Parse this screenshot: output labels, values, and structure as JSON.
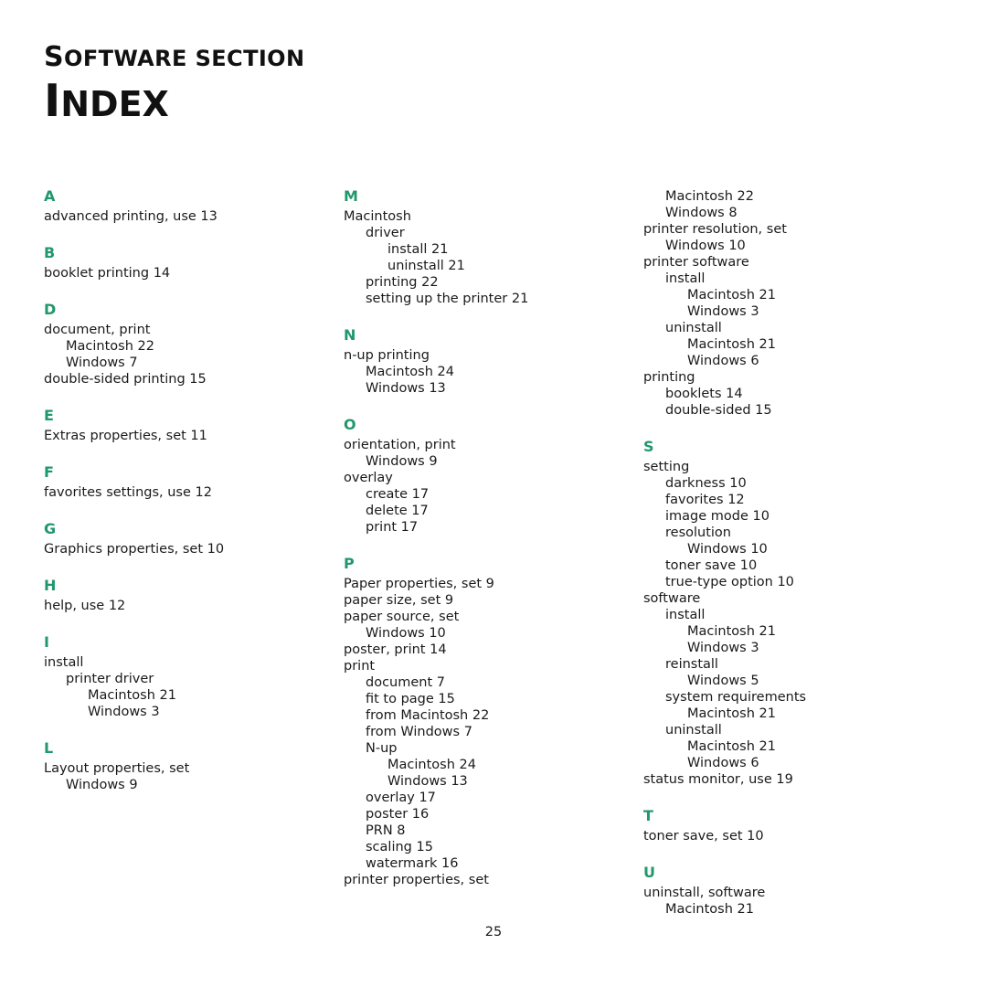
{
  "header": {
    "kicker": "Software section",
    "kicker_first": "S",
    "kicker_rest": "OFTWARE SECTION",
    "title": "Index",
    "title_first": "I",
    "title_rest": "NDEX"
  },
  "colors": {
    "letter_heading": "#21986c",
    "body_text": "#1a1a1a",
    "background": "#ffffff"
  },
  "footer": {
    "page_number": "25"
  },
  "columns": [
    {
      "id": "column-1",
      "continuation": [],
      "sections": [
        {
          "letter": "A",
          "entries": [
            {
              "text": "advanced printing, use 13",
              "level": 0
            }
          ]
        },
        {
          "letter": "B",
          "entries": [
            {
              "text": "booklet printing 14",
              "level": 0
            }
          ]
        },
        {
          "letter": "D",
          "entries": [
            {
              "text": "document, print",
              "level": 0
            },
            {
              "text": "Macintosh 22",
              "level": 1
            },
            {
              "text": "Windows 7",
              "level": 1
            },
            {
              "text": "double-sided printing 15",
              "level": 0
            }
          ]
        },
        {
          "letter": "E",
          "entries": [
            {
              "text": "Extras properties, set 11",
              "level": 0
            }
          ]
        },
        {
          "letter": "F",
          "entries": [
            {
              "text": "favorites settings, use 12",
              "level": 0
            }
          ]
        },
        {
          "letter": "G",
          "entries": [
            {
              "text": "Graphics properties, set 10",
              "level": 0
            }
          ]
        },
        {
          "letter": "H",
          "entries": [
            {
              "text": "help, use 12",
              "level": 0
            }
          ]
        },
        {
          "letter": "I",
          "entries": [
            {
              "text": "install",
              "level": 0
            },
            {
              "text": "printer driver",
              "level": 1
            },
            {
              "text": "Macintosh 21",
              "level": 2
            },
            {
              "text": "Windows 3",
              "level": 2
            }
          ]
        },
        {
          "letter": "L",
          "entries": [
            {
              "text": "Layout properties, set",
              "level": 0
            },
            {
              "text": "Windows 9",
              "level": 1
            }
          ]
        }
      ]
    },
    {
      "id": "column-2",
      "continuation": [],
      "sections": [
        {
          "letter": "M",
          "entries": [
            {
              "text": "Macintosh",
              "level": 0
            },
            {
              "text": "driver",
              "level": 1
            },
            {
              "text": "install 21",
              "level": 2
            },
            {
              "text": "uninstall 21",
              "level": 2
            },
            {
              "text": "printing 22",
              "level": 1
            },
            {
              "text": "setting up the printer 21",
              "level": 1
            }
          ]
        },
        {
          "letter": "N",
          "entries": [
            {
              "text": "n-up printing",
              "level": 0
            },
            {
              "text": "Macintosh 24",
              "level": 1
            },
            {
              "text": "Windows 13",
              "level": 1
            }
          ]
        },
        {
          "letter": "O",
          "entries": [
            {
              "text": "orientation, print",
              "level": 0
            },
            {
              "text": "Windows 9",
              "level": 1
            },
            {
              "text": "overlay",
              "level": 0
            },
            {
              "text": "create 17",
              "level": 1
            },
            {
              "text": "delete 17",
              "level": 1
            },
            {
              "text": "print 17",
              "level": 1
            }
          ]
        },
        {
          "letter": "P",
          "entries": [
            {
              "text": "Paper properties, set 9",
              "level": 0
            },
            {
              "text": "paper size, set 9",
              "level": 0
            },
            {
              "text": "paper source, set",
              "level": 0
            },
            {
              "text": "Windows 10",
              "level": 1
            },
            {
              "text": "poster, print 14",
              "level": 0
            },
            {
              "text": "print",
              "level": 0
            },
            {
              "text": "document 7",
              "level": 1
            },
            {
              "text": "fit to page 15",
              "level": 1
            },
            {
              "text": "from Macintosh 22",
              "level": 1
            },
            {
              "text": "from Windows 7",
              "level": 1
            },
            {
              "text": "N-up",
              "level": 1
            },
            {
              "text": "Macintosh 24",
              "level": 2
            },
            {
              "text": "Windows 13",
              "level": 2
            },
            {
              "text": "overlay 17",
              "level": 1
            },
            {
              "text": "poster 16",
              "level": 1
            },
            {
              "text": "PRN 8",
              "level": 1
            },
            {
              "text": "scaling 15",
              "level": 1
            },
            {
              "text": "watermark 16",
              "level": 1
            },
            {
              "text": "printer properties, set",
              "level": 0
            }
          ]
        }
      ]
    },
    {
      "id": "column-3",
      "continuation": [
        {
          "text": "Macintosh 22",
          "level": 1
        },
        {
          "text": "Windows 8",
          "level": 1
        },
        {
          "text": "printer resolution, set",
          "level": 0
        },
        {
          "text": "Windows 10",
          "level": 1
        },
        {
          "text": "printer software",
          "level": 0
        },
        {
          "text": "install",
          "level": 1
        },
        {
          "text": "Macintosh 21",
          "level": 2
        },
        {
          "text": "Windows 3",
          "level": 2
        },
        {
          "text": "uninstall",
          "level": 1
        },
        {
          "text": "Macintosh 21",
          "level": 2
        },
        {
          "text": "Windows 6",
          "level": 2
        },
        {
          "text": "printing",
          "level": 0
        },
        {
          "text": "booklets 14",
          "level": 1
        },
        {
          "text": "double-sided 15",
          "level": 1
        }
      ],
      "sections": [
        {
          "letter": "S",
          "entries": [
            {
              "text": "setting",
              "level": 0
            },
            {
              "text": "darkness 10",
              "level": 1
            },
            {
              "text": "favorites 12",
              "level": 1
            },
            {
              "text": "image mode 10",
              "level": 1
            },
            {
              "text": "resolution",
              "level": 1
            },
            {
              "text": "Windows 10",
              "level": 2
            },
            {
              "text": "toner save 10",
              "level": 1
            },
            {
              "text": "true-type option 10",
              "level": 1
            },
            {
              "text": "software",
              "level": 0
            },
            {
              "text": "install",
              "level": 1
            },
            {
              "text": "Macintosh 21",
              "level": 2
            },
            {
              "text": "Windows 3",
              "level": 2
            },
            {
              "text": "reinstall",
              "level": 1
            },
            {
              "text": "Windows 5",
              "level": 2
            },
            {
              "text": "system requirements",
              "level": 1
            },
            {
              "text": "Macintosh 21",
              "level": 2
            },
            {
              "text": "uninstall",
              "level": 1
            },
            {
              "text": "Macintosh 21",
              "level": 2
            },
            {
              "text": "Windows 6",
              "level": 2
            },
            {
              "text": "status monitor, use 19",
              "level": 0
            }
          ]
        },
        {
          "letter": "T",
          "entries": [
            {
              "text": "toner save, set 10",
              "level": 0
            }
          ]
        },
        {
          "letter": "U",
          "entries": [
            {
              "text": "uninstall, software",
              "level": 0
            },
            {
              "text": "Macintosh 21",
              "level": 1
            }
          ]
        }
      ]
    }
  ]
}
